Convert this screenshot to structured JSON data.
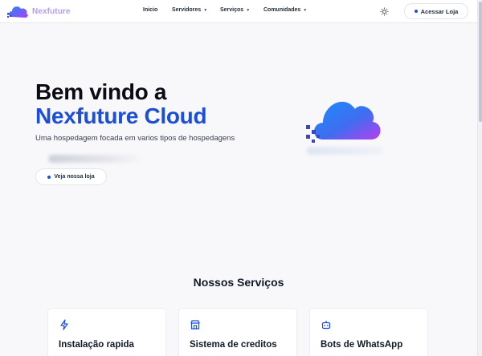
{
  "nav": {
    "brand": "Nexfuture",
    "links": [
      {
        "label": "Inicio",
        "has_caret": false
      },
      {
        "label": "Servidores",
        "has_caret": true
      },
      {
        "label": "Serviços",
        "has_caret": true
      },
      {
        "label": "Comunidades",
        "has_caret": true
      }
    ],
    "theme_icon": "sun-icon",
    "store_button": "Acessar Loja"
  },
  "hero": {
    "title_line1": "Bem vindo a",
    "title_line2": "Nexfuture Cloud",
    "subtitle": "Uma hospedagem focada em varios tipos de hospedagens",
    "cta": "Veja nossa loja"
  },
  "services": {
    "title": "Nossos Serviços",
    "cards": [
      {
        "icon": "lightning-icon",
        "title": "Instalação rapida"
      },
      {
        "icon": "store-icon",
        "title": "Sistema de creditos"
      },
      {
        "icon": "bot-icon",
        "title": "Bots de WhatsApp"
      }
    ]
  },
  "colors": {
    "accent": "#1d4ed8",
    "brand": "#b79cf3",
    "background": "#f8f8fb"
  }
}
